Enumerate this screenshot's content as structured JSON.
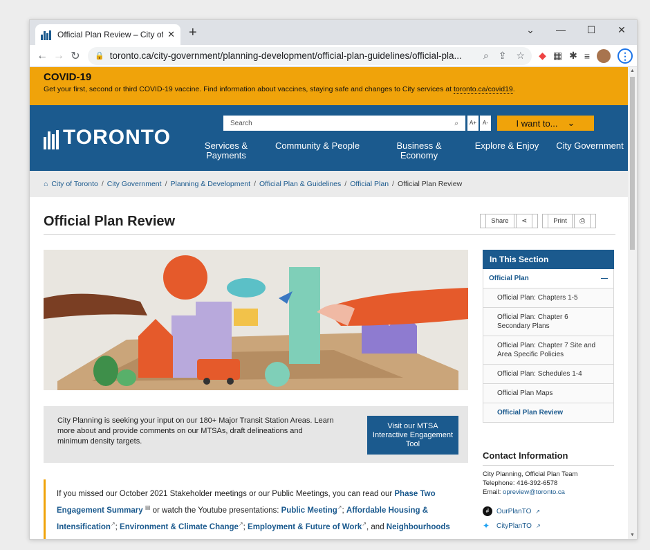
{
  "browser": {
    "tab_title": "Official Plan Review – City of Toro",
    "new_tab": "+",
    "url": "toronto.ca/city-government/planning-development/official-plan-guidelines/official-pla...",
    "win_min": "—",
    "win_max": "☐",
    "win_close": "✕",
    "win_dropdown": "⌄"
  },
  "covid": {
    "title": "COVID-19",
    "text": "Get your first, second or third COVID-19 vaccine. Find information about vaccines, staying safe and changes to City services at ",
    "link": "toronto.ca/covid19",
    "period": "."
  },
  "header": {
    "logo_text": "TORONTO",
    "search_placeholder": "Search",
    "font_larger": "A+",
    "font_smaller": "A-",
    "i_want": "I want to...",
    "nav": [
      {
        "label": "Services & Payments"
      },
      {
        "label": "Community & People"
      },
      {
        "label": "Business & Economy"
      },
      {
        "label": "Explore & Enjoy"
      },
      {
        "label": "City Government"
      }
    ]
  },
  "breadcrumb": [
    "City of Toronto",
    "City Government",
    "Planning & Development",
    "Official Plan & Guidelines",
    "Official Plan",
    "Official Plan Review"
  ],
  "main": {
    "title": "Official Plan Review",
    "share": "Share",
    "print": "Print",
    "info_text": "City Planning is seeking your input on our 180+ Major Transit Station Areas. Learn more about and provide comments on our MTSAs, draft delineations and minimum density targets.",
    "mtsa_button": "Visit our MTSA Interactive Engagement Tool",
    "missed_intro": "If you missed our October 2021 Stakeholder meetings or our Public Meetings, you can read our ",
    "missed_link1": "Phase Two Engagement Summary",
    "missed_mid": " or watch the Youtube presentations: ",
    "missed_link2": "Public Meeting",
    "missed_link3": "Affordable Housing & Intensification",
    "missed_link4": "Environment & Climate Change",
    "missed_link5": "Employment & Future of Work",
    "missed_and": ", and ",
    "missed_link6": "Neighbourhoods & Complete Communities",
    "missed_end": "."
  },
  "sidebar": {
    "heading": "In This Section",
    "top_item": "Official Plan",
    "collapse": "—",
    "items": [
      "Official Plan: Chapters 1-5",
      "Official Plan: Chapter 6 Secondary Plans",
      "Official Plan: Chapter 7 Site and Area Specific Policies",
      "Official Plan: Schedules 1-4",
      "Official Plan Maps",
      "Official Plan Review"
    ]
  },
  "contact": {
    "heading": "Contact Information",
    "team": "City Planning, Official Plan Team",
    "telephone": "Telephone: 416-392-6578",
    "email_label": "Email: ",
    "email": "opreview@toronto.ca",
    "social1": "OurPlanTO",
    "social2": "CityPlanTO"
  },
  "colors": {
    "brand_blue": "#1b5a8e",
    "accent_orange": "#f0a30a"
  }
}
